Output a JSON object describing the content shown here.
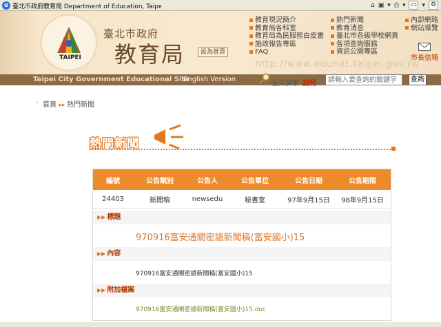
{
  "window": {
    "title": "臺北市政府教育局 Department of Education, Taipei ..."
  },
  "header": {
    "logo_text": "TAIPEI",
    "org_name": "臺北市政府",
    "site_title": "教育局",
    "home_link": "設為首頁",
    "menu_col1": [
      "教育現況簡介",
      "教育局各科室",
      "教育局為民服務白皮書",
      "施政報告專區",
      "FAQ"
    ],
    "menu_col2": [
      "熱門新聞",
      "教育消息",
      "臺北市各級學校網頁",
      "各項查詢服務",
      "資訊公開專區"
    ],
    "menu_col3": [
      "內部網路",
      "網站導覽"
    ],
    "mayor_mail": "市長信箱",
    "watermark_url": "http://www.edunet.taipei.gov.tw"
  },
  "navbar": {
    "site_name_en": "Taipei City Government Educational Site",
    "english_version": "English Version"
  },
  "search": {
    "label": "全文檢索",
    "help": "說明",
    "placeholder": "請輸入要查詢的關鍵字",
    "button": "查詢"
  },
  "breadcrumb": {
    "home": "首頁",
    "current": "熱門新聞"
  },
  "page": {
    "heading": "熱門新聞"
  },
  "table": {
    "headers": [
      "編號",
      "公告類別",
      "公告人",
      "公告單位",
      "公告日期",
      "公告期限"
    ],
    "row": [
      "24403",
      "新聞稿",
      "newsedu",
      "秘書室",
      "97年9月15日",
      "98年9月15日"
    ]
  },
  "detail": {
    "title_label": "標題",
    "title_value": "970916富安通關密語新聞稿(富安國小)15",
    "content_label": "內容",
    "content_value": "970916富安通關密語新聞稿(富安國小)15",
    "attachment_label": "附加檔案",
    "attachment_value": "970916富安通關密語新聞稿(富安國小)15.doc"
  },
  "colors": {
    "accent": "#e07820",
    "header_bg": "#f4e3c9",
    "navbar_bg": "#8c6a43",
    "table_header_bg": "#ec8b2c"
  }
}
